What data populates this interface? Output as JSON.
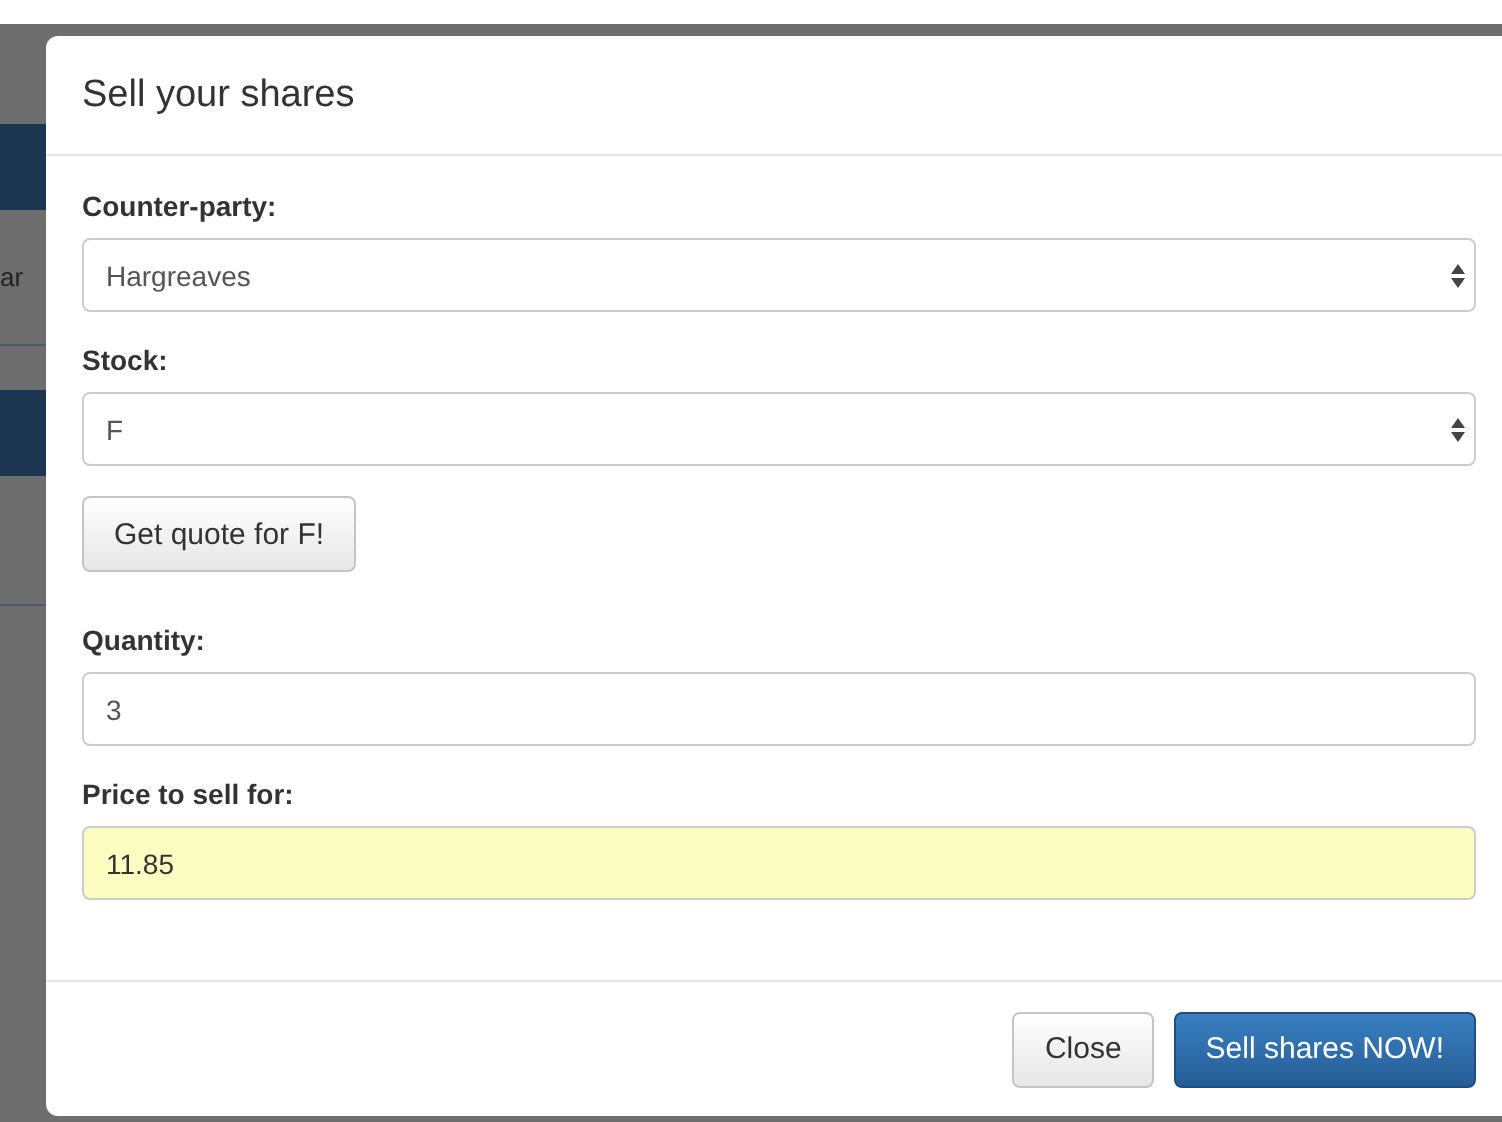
{
  "background_page": {
    "text_fragment": "ar"
  },
  "dialog": {
    "title": "Sell your shares",
    "fields": [
      {
        "kind": "select",
        "label": "Counter-party:",
        "value": "Hargreaves"
      },
      {
        "kind": "select",
        "label": "Stock:",
        "value": "F"
      },
      {
        "kind": "button",
        "text": "Get quote for F!"
      },
      {
        "kind": "input",
        "label": "Quantity:",
        "value": "3",
        "highlighted": false
      },
      {
        "kind": "input",
        "label": "Price to sell for:",
        "value": "11.85",
        "highlighted": true
      }
    ],
    "buttons": [
      {
        "text": "Close",
        "kind": "default"
      },
      {
        "text": "Sell shares NOW!",
        "kind": "primary"
      }
    ]
  }
}
